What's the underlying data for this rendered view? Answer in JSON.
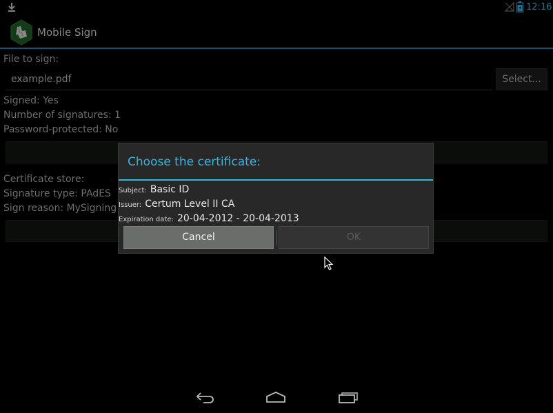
{
  "status_bar": {
    "time": "12:16",
    "icons": [
      "download-icon",
      "signal-icon",
      "battery-icon"
    ]
  },
  "action_bar": {
    "title": "Mobile Sign",
    "icon": "app-logo-icon"
  },
  "main": {
    "file_label": "File to sign:",
    "file_value": "example.pdf",
    "select_label": "Select...",
    "signed": "Signed: Yes",
    "num_signatures": "Number of signatures: 1",
    "password_protected": "Password-protected: No",
    "certificate_store": "Certificate store:",
    "signature_type": "Signature type: PAdES",
    "sign_reason": "Sign reason: MySigning"
  },
  "dialog": {
    "title": "Choose the certificate:",
    "subject_key": "Subject:",
    "subject_value": "Basic ID",
    "issuer_key": "Issuer:",
    "issuer_value": "Certum Level II CA",
    "expiration_key": "Expiration date:",
    "expiration_value": "20-04-2012 - 20-04-2013",
    "cancel_label": "Cancel",
    "ok_label": "OK"
  },
  "colors": {
    "accent": "#33b5e5",
    "background": "#000000"
  }
}
